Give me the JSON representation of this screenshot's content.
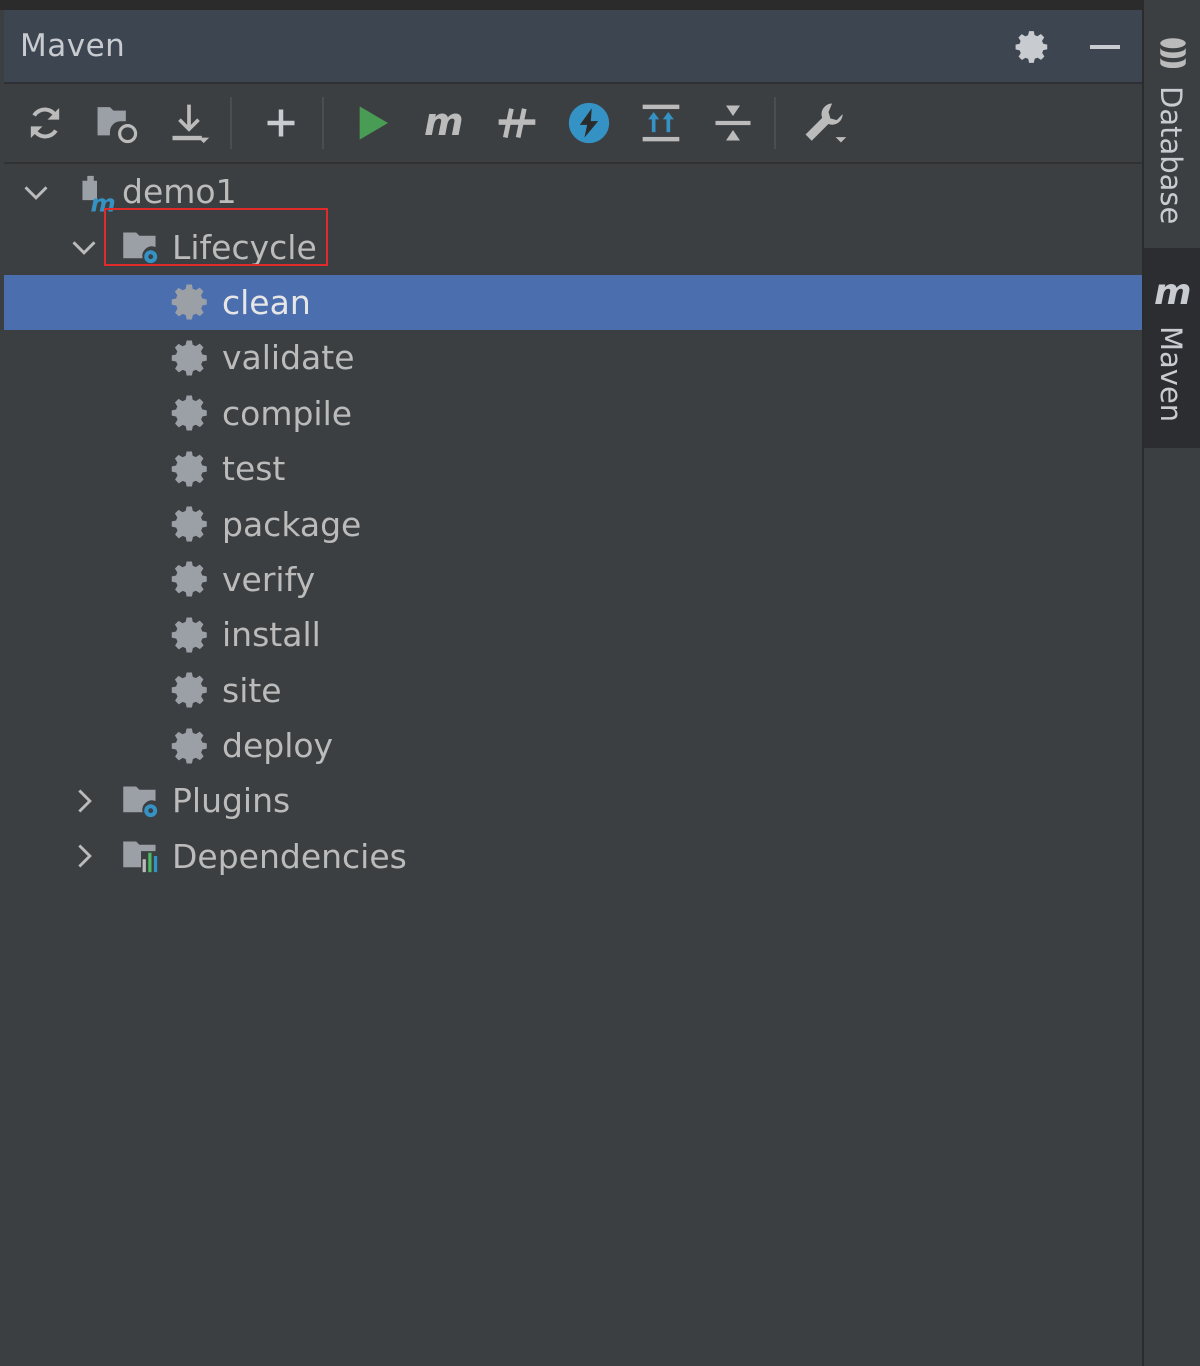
{
  "window": {
    "title": "Maven"
  },
  "toolbar": {
    "buttons": [
      {
        "name": "reload-icon"
      },
      {
        "name": "generate-sources-icon"
      },
      {
        "name": "download-icon"
      },
      {
        "name": "add-project-icon"
      },
      {
        "name": "run-icon"
      },
      {
        "name": "execute-goal-icon"
      },
      {
        "name": "toggle-offline-icon"
      },
      {
        "name": "skip-tests-icon"
      },
      {
        "name": "show-dependencies-icon"
      },
      {
        "name": "collapse-all-icon"
      },
      {
        "name": "settings-wrench-icon"
      }
    ]
  },
  "tree": {
    "project": "demo1",
    "lifecycle_label": "Lifecycle",
    "goals": [
      "clean",
      "validate",
      "compile",
      "test",
      "package",
      "verify",
      "install",
      "site",
      "deploy"
    ],
    "selected_goal": "clean",
    "plugins_label": "Plugins",
    "dependencies_label": "Dependencies"
  },
  "sidebar": {
    "tabs": [
      {
        "label": "Database",
        "icon": "database-icon"
      },
      {
        "label": "Maven",
        "icon": "maven-icon",
        "active": true
      }
    ]
  },
  "colors": {
    "background": "#3c3f41",
    "title_bar": "#3d4550",
    "selection": "#4b6eaf",
    "run_green": "#499c54",
    "accent_blue": "#3592c4",
    "highlight_red": "#e02b2b"
  }
}
